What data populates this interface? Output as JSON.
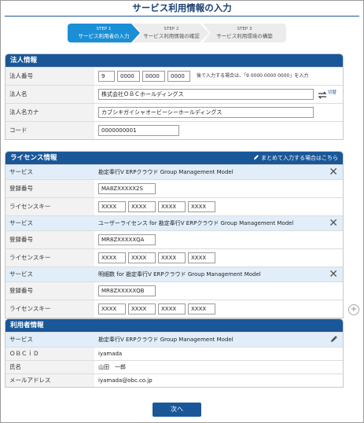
{
  "page": {
    "title": "サービス利用情報の入力",
    "next_label": "次へ"
  },
  "steps": [
    {
      "num": "STEP 1",
      "label": "サービス利用者の入力"
    },
    {
      "num": "STEP 2",
      "label": "サービス利用情報の確認"
    },
    {
      "num": "STEP 3",
      "label": "サービス利用環境の構築"
    }
  ],
  "corp": {
    "header": "法人情報",
    "number_label": "法人番号",
    "number_values": [
      "9",
      "0000",
      "0000",
      "0000"
    ],
    "number_note": "後で入力する場合は、「9 0000 0000 0000」を入力",
    "name_label": "法人名",
    "name_value": "株式会社ＯＢＣホールディングス",
    "swap_label": "切替",
    "kana_label": "法人名カナ",
    "kana_value": "カブシキガイシャオービーシーホールディングス",
    "code_label": "コード",
    "code_value": "0000000001"
  },
  "license": {
    "header": "ライセンス情報",
    "bulk_link": "まとめて入力する場合はこちら",
    "service_label": "サービス",
    "reg_label": "登録番号",
    "key_label": "ライセンスキー",
    "items": [
      {
        "service": "勘定奉行V ERPクラウド Group Management Model",
        "reg": "MA8ZXXXXX2S",
        "keys": [
          "XXXX",
          "XXXX",
          "XXXX",
          "XXXX"
        ]
      },
      {
        "service": "ユーザーライセンス for 勘定奉行V ERPクラウド Group Management Model",
        "reg": "MR8ZXXXXXQA",
        "keys": [
          "XXXX",
          "XXXX",
          "XXXX",
          "XXXX"
        ]
      },
      {
        "service": "明細数 for 勘定奉行V ERPクラウド Group Management Model",
        "reg": "MR8ZXXXXXQB",
        "keys": [
          "XXXX",
          "XXXX",
          "XXXX",
          "XXXX"
        ]
      }
    ]
  },
  "user": {
    "header": "利用者情報",
    "service_label": "サービス",
    "service_value": "勘定奉行V ERPクラウド Group Management Model",
    "obcid_label": "ＯＢＣｉＤ",
    "obcid_value": "iyamada",
    "name_label": "氏名",
    "name_value": "山田　一郎",
    "email_label": "メールアドレス",
    "email_value": "iyamada@obc.co.jp"
  },
  "colors": {
    "primary": "#1a5799",
    "step_active": "#1a8fd6",
    "service_row": "#e1eef9"
  }
}
